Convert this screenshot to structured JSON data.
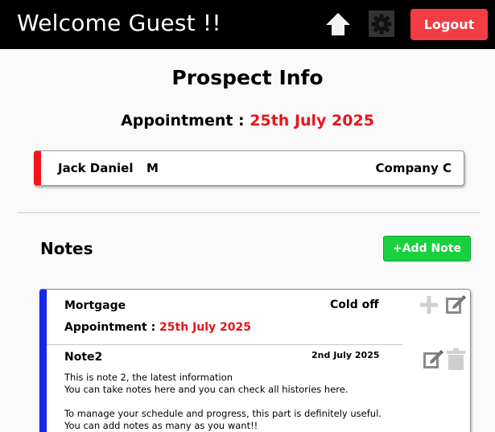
{
  "header": {
    "welcome_text": "Welcome Guest !!",
    "logout_label": "Logout",
    "icons": [
      "home-icon",
      "gear-icon"
    ]
  },
  "page": {
    "title": "Prospect Info",
    "appointment_label": "Appointment :",
    "appointment_date": "25th July 2025"
  },
  "prospect": {
    "name": "Jack Daniel",
    "gender": "M",
    "company": "Company C"
  },
  "notes": {
    "title": "Notes",
    "add_label": "+Add Note",
    "panel": {
      "type": "Mortgage",
      "status": "Cold off",
      "appointment_label": "Appointment :",
      "appointment_date": "25th July 2025"
    },
    "items": [
      {
        "title": "Note2",
        "date": "2nd July 2025",
        "body": "This is note 2, the latest information\nYou can take notes here and you can check all histories here.\n\nTo manage your schedule and progress, this part is definitely useful.\nYou can add notes as many as you want!!"
      }
    ]
  },
  "colors": {
    "header_bg": "#000000",
    "logout_bg": "#f33d44",
    "accent_red": "#e8131b",
    "prospect_stripe": "#f4141c",
    "add_note_bg": "#19d13f",
    "note_stripe": "#1727f0"
  }
}
